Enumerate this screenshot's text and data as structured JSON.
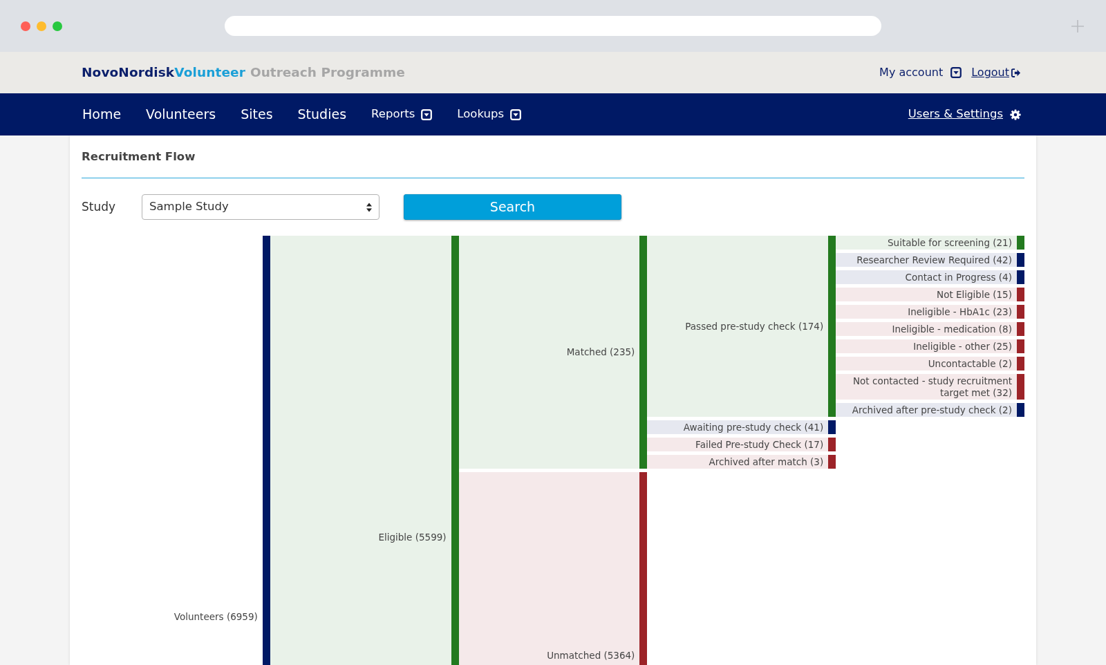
{
  "header": {
    "logo": {
      "brand": "NovoNordisk",
      "product": "Volunteer"
    },
    "tagline": "Outreach Programme",
    "account_menu": "My account",
    "logout": "Logout"
  },
  "nav": {
    "items": [
      {
        "label": "Home",
        "kind": "link"
      },
      {
        "label": "Volunteers",
        "kind": "link"
      },
      {
        "label": "Sites",
        "kind": "link"
      },
      {
        "label": "Studies",
        "kind": "link"
      },
      {
        "label": "Reports",
        "kind": "dropdown"
      },
      {
        "label": "Lookups",
        "kind": "dropdown"
      }
    ],
    "settings": "Users & Settings"
  },
  "panel": {
    "title": "Recruitment Flow",
    "study_label": "Study",
    "study_select": {
      "value": "Sample Study"
    },
    "search_button": "Search"
  },
  "flow": {
    "root": {
      "label": "Volunteers (6959)",
      "color": "#001965",
      "children": [
        {
          "label": "Eligible (5599)",
          "color": "#237a1f",
          "children": [
            {
              "label": "Matched (235)",
              "color": "#237a1f",
              "children": [
                {
                  "label": "Passed pre-study check (174)",
                  "color": "#237a1f",
                  "children": [
                    {
                      "label": "Suitable for screening (21)",
                      "color": "#237a1f"
                    },
                    {
                      "label": "Researcher Review Required (42)",
                      "color": "#001965"
                    },
                    {
                      "label": "Contact in Progress (4)",
                      "color": "#001965"
                    },
                    {
                      "label": "Not Eligible (15)",
                      "color": "#9c2328"
                    },
                    {
                      "label": "Ineligible - HbA1c (23)",
                      "color": "#9c2328"
                    },
                    {
                      "label": "Ineligible - medication (8)",
                      "color": "#9c2328"
                    },
                    {
                      "label": "Ineligible - other (25)",
                      "color": "#9c2328"
                    },
                    {
                      "label": "Uncontactable (2)",
                      "color": "#9c2328"
                    },
                    {
                      "label": "Not contacted - study recruitment target met (32)",
                      "color": "#9c2328"
                    },
                    {
                      "label": "Archived after pre-study check (2)",
                      "color": "#001965"
                    }
                  ]
                },
                {
                  "label": "Awaiting pre-study check (41)",
                  "color": "#001965"
                },
                {
                  "label": "Failed Pre-study Check (17)",
                  "color": "#9c2328"
                },
                {
                  "label": "Archived after match (3)",
                  "color": "#9c2328"
                }
              ]
            },
            {
              "label": "Unmatched (5364)",
              "color": "#9c2328"
            }
          ]
        }
      ]
    }
  }
}
